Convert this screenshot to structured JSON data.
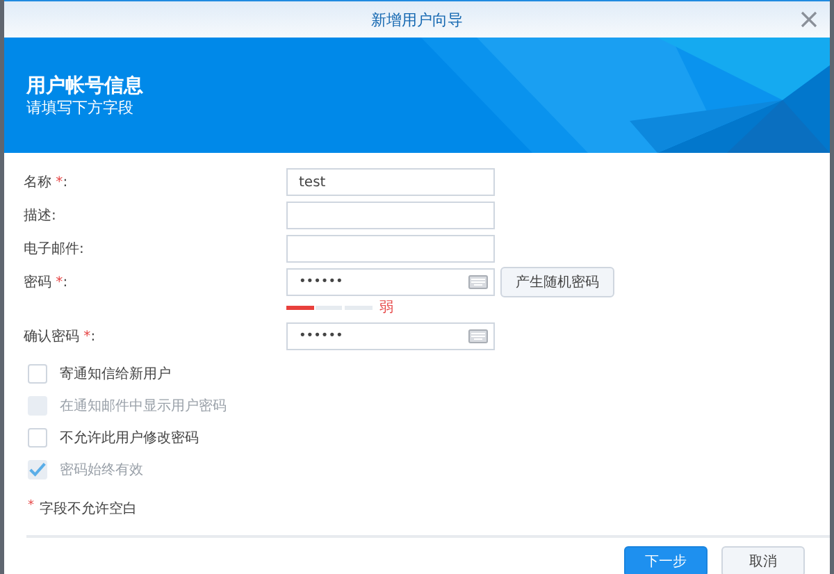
{
  "window": {
    "title": "新增用户向导"
  },
  "header": {
    "title": "用户帐号信息",
    "subtitle": "请填写下方字段"
  },
  "fields": [
    {
      "kind": "text",
      "label": "名称",
      "required": true,
      "colon": ":",
      "value": "test"
    },
    {
      "kind": "text",
      "label": "描述",
      "required": false,
      "colon": ":"
    },
    {
      "kind": "text",
      "label": "电子邮件",
      "required": false,
      "colon": ":"
    },
    {
      "kind": "password",
      "label": "密码",
      "required": true,
      "colon": ":",
      "value": "••••••",
      "button": "产生随机密码"
    },
    {
      "kind": "strength",
      "level": 0.33,
      "reading": "弱"
    },
    {
      "kind": "password",
      "label": "确认密码",
      "required": true,
      "colon": ":",
      "value": "••••••"
    }
  ],
  "options": [
    {
      "label": "寄通知信给新用户",
      "checked": false,
      "disabled": false
    },
    {
      "label": "在通知邮件中显示用户密码",
      "checked": false,
      "disabled": true
    },
    {
      "label": "不允许此用户修改密码",
      "checked": false,
      "disabled": false
    },
    {
      "label": "密码始终有效",
      "checked": true,
      "disabled": true
    }
  ],
  "required_note": {
    "mark": "*",
    "text": "字段不允许空白"
  },
  "buttons": [
    {
      "label": "下一步",
      "kind": "primary"
    },
    {
      "label": "取消",
      "kind": "secondary"
    }
  ]
}
